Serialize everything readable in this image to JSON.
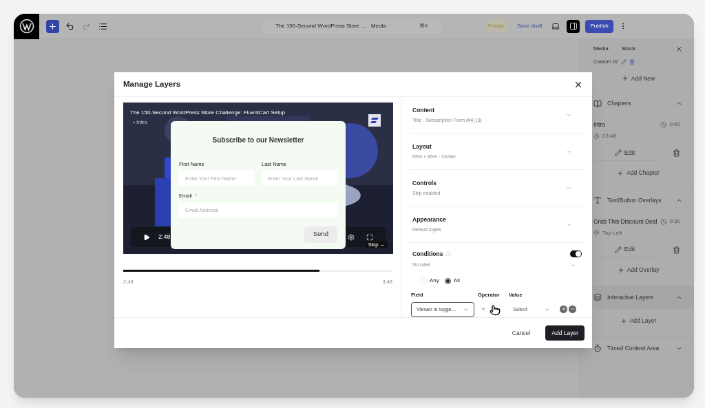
{
  "toolbar": {
    "command_title": "The 150-Second WordPress Store ...",
    "command_context": "Media",
    "shortcut": "⌘K",
    "status": "Private",
    "save": "Save draft",
    "publish": "Publish",
    "sidebar_toggle_on": true,
    "redo_disabled": true
  },
  "sidebar": {
    "tabs": [
      {
        "label": "Media"
      },
      {
        "label": "Block"
      }
    ],
    "custom_label": "Custom 02",
    "add_new": "Add New",
    "sections": [
      {
        "kind": "chapters",
        "title": "Chapters",
        "expanded": true,
        "items": [
          {
            "title": "Intro",
            "time": "0:00",
            "kind": "duration",
            "meta": "03:48",
            "edit": "Edit"
          }
        ],
        "add": "Add Chapter"
      },
      {
        "kind": "overlays",
        "title": "Text/Button Overlays",
        "expanded": true,
        "items": [
          {
            "title": "Grab This Discount Deal",
            "time": "0:30",
            "kind": "position",
            "meta": "Top Left",
            "edit": "Edit"
          }
        ],
        "add": "Add Overlay"
      },
      {
        "kind": "layers",
        "title": "Interactive Layers",
        "expanded": true,
        "add": "Add Layer"
      },
      {
        "kind": "timed",
        "title": "Timed Content Area",
        "expanded": false
      }
    ]
  },
  "modal": {
    "title": "Manage Layers",
    "video": {
      "title": "The 150-Second WordPress Store Challenge: FluentCart Setup",
      "chapter": "• Intro",
      "time": "2:48",
      "skip": "Skip →"
    },
    "form": {
      "title": "Subscribe to our Newsletter",
      "fields": [
        {
          "label": "First Name",
          "placeholder": "Enter Your First Name"
        },
        {
          "label": "Last Name",
          "placeholder": "Enter Your Last Name"
        },
        {
          "label": "Email",
          "mark": "*",
          "placeholder": "Email Address"
        }
      ],
      "button": "Send"
    },
    "progress": {
      "level": 0.73,
      "current": "2:48",
      "total": "3:48"
    },
    "sections": [
      {
        "title": "Content",
        "summary": "Title · Subscription Form (#4) (3)",
        "expanded": false
      },
      {
        "title": "Layout",
        "summary": "65% × 85% · Center",
        "expanded": false
      },
      {
        "title": "Controls",
        "summary": "Skip enabled",
        "expanded": false
      },
      {
        "title": "Appearance",
        "summary": "Default styles",
        "expanded": false
      }
    ],
    "conditions": {
      "title": "Conditions",
      "summary": "No rules",
      "enabled": true,
      "expanded": true,
      "match": [
        {
          "label": "Any",
          "selected": false
        },
        {
          "label": "All",
          "selected": true
        }
      ],
      "rule": {
        "field_label": "Field",
        "field": "Viewer is logge...",
        "operator_label": "Operator",
        "operator": "=",
        "value_label": "Value",
        "value_placeholder": "Select"
      }
    },
    "buttons": {
      "cancel": "Cancel",
      "submit": "Add Layer"
    }
  }
}
